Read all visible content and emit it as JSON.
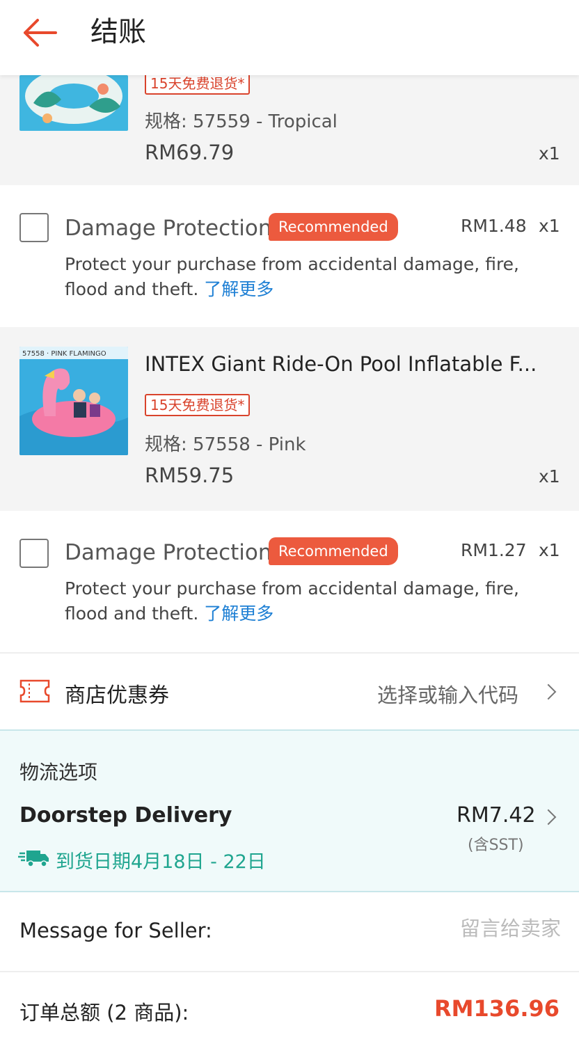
{
  "header": {
    "title": "结账"
  },
  "items": [
    {
      "return_tag": "15天免费退货*",
      "spec": "规格: 57559 - Tropical",
      "price": "RM69.79",
      "qty": "x1"
    },
    {
      "name": "INTEX Giant Ride-On Pool Inflatable F...",
      "thumb_text": "57558 · PINK FLAMINGO",
      "return_tag": "15天免费退货*",
      "spec": "规格: 57558 - Pink",
      "price": "RM59.75",
      "qty": "x1"
    }
  ],
  "protections": [
    {
      "title": "Damage Protection",
      "badge": "Recommended",
      "price": "RM1.48",
      "qty": "x1",
      "desc_line1": "Protect your purchase from accidental damage, fire,",
      "desc_line2": "flood and theft.",
      "link": "了解更多"
    },
    {
      "title": "Damage Protection",
      "badge": "Recommended",
      "price": "RM1.27",
      "qty": "x1",
      "desc_line1": "Protect your purchase from accidental damage, fire,",
      "desc_line2": "flood and theft.",
      "link": "了解更多"
    }
  ],
  "coupon": {
    "label": "商店优惠券",
    "hint": "选择或输入代码"
  },
  "shipping": {
    "heading": "物流选项",
    "method": "Doorstep Delivery",
    "price": "RM7.42",
    "tax_note": "(含SST)",
    "eta": "到货日期4月18日 - 22日"
  },
  "message": {
    "label": "Message for Seller:",
    "placeholder": "留言给卖家"
  },
  "total": {
    "label": "订单总额 (2 商品):",
    "value": "RM136.96"
  },
  "colors": {
    "accent": "#e8492c",
    "badge": "#ec5a3e",
    "link": "#1d7fd4",
    "eta": "#1fa58f"
  },
  "icons": [
    "arrow-left-icon",
    "coupon-ticket-icon",
    "chevron-right-icon",
    "delivery-truck-icon"
  ]
}
